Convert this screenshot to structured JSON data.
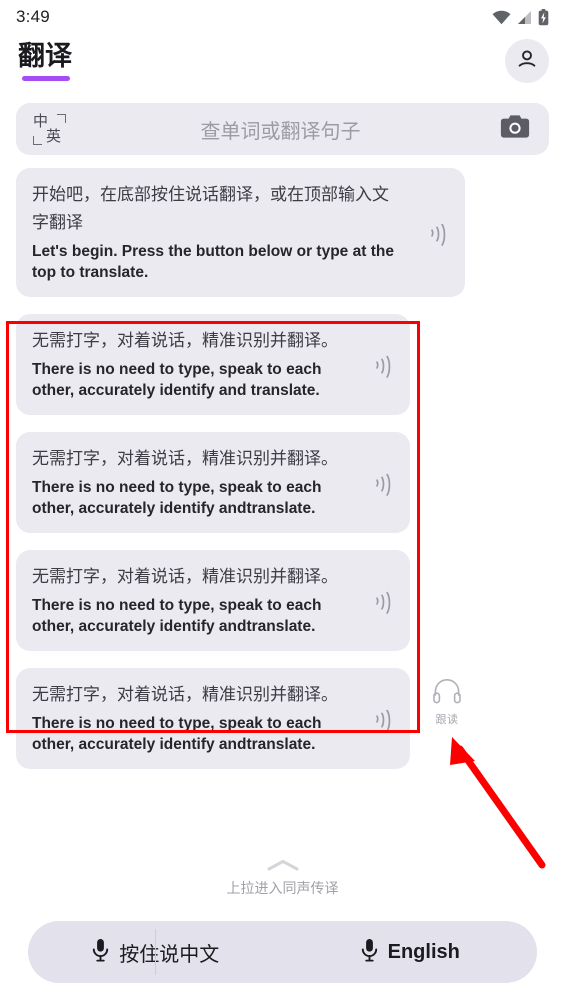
{
  "status_bar": {
    "time": "3:49",
    "icons": [
      "wifi-icon",
      "cellular-signal-icon",
      "battery-charging-icon"
    ]
  },
  "header": {
    "title": "翻译",
    "underline_color": "#a64cf5",
    "avatar_icon": "person-icon"
  },
  "search": {
    "lang_from": "中",
    "lang_to": "英",
    "placeholder": "查单词或翻译句子",
    "camera_icon": "camera-icon"
  },
  "chat": {
    "messages": [
      {
        "zh": "开始吧，在底部按住说话翻译，或在顶部输入文字翻译",
        "en": "Let's begin. Press the button below or type at the top to translate.",
        "speaker_icon": "speaker-wave-icon"
      },
      {
        "zh": "无需打字，对着说话，精准识别并翻译。",
        "en": "There is no need to type, speak to each other, accurately identify and translate.",
        "speaker_icon": "speaker-wave-icon"
      },
      {
        "zh": "无需打字，对着说话，精准识别并翻译。",
        "en": "There is no need to type, speak to each other, accurately identify andtranslate.",
        "speaker_icon": "speaker-wave-icon"
      },
      {
        "zh": "无需打字，对着说话，精准识别并翻译。",
        "en": "There is no need to type, speak to each other, accurately identify andtranslate.",
        "speaker_icon": "speaker-wave-icon"
      },
      {
        "zh": "无需打字，对着说话，精准识别并翻译。",
        "en": "There is no need to type, speak to each other, accurately identify andtranslate.",
        "speaker_icon": "speaker-wave-icon"
      }
    ]
  },
  "follow_read": {
    "icon": "headphones-icon",
    "label": "跟读"
  },
  "pull_up": {
    "icon": "chevron-up-icon",
    "label": "上拉进入同声传译"
  },
  "mic_bar": {
    "left_label": "按住说中文",
    "right_label": "English",
    "mic_icon": "microphone-icon"
  },
  "annotation": {
    "box_color": "#fc0000",
    "arrow_color": "#fc0000"
  }
}
